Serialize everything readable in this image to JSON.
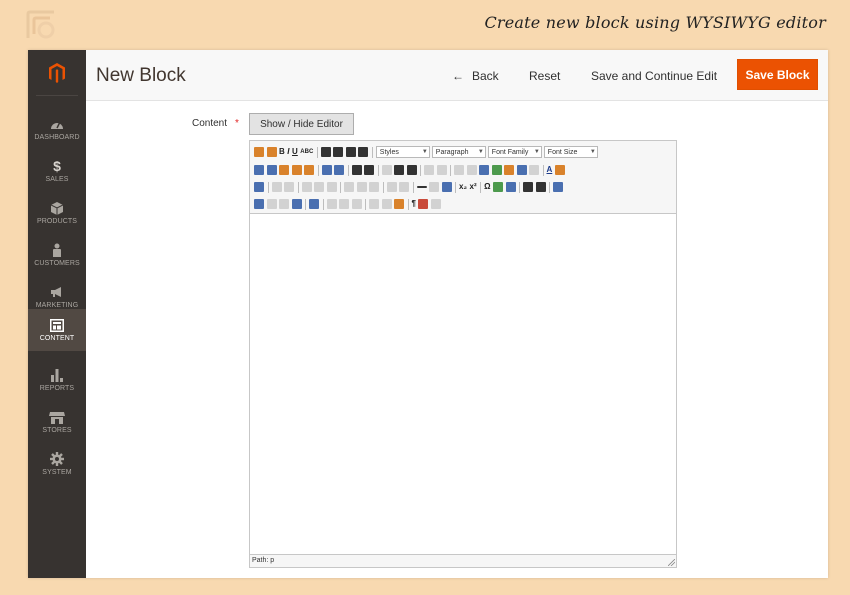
{
  "caption": "Create new block using WYSIWYG editor",
  "colors": {
    "accent": "#eb5202",
    "sidebar": "#373330",
    "background": "#f8d9b0"
  },
  "sidebar": {
    "items": [
      {
        "label": "DASHBOARD",
        "icon": "dashboard-icon"
      },
      {
        "label": "SALES",
        "icon": "dollar-icon"
      },
      {
        "label": "PRODUCTS",
        "icon": "cube-icon"
      },
      {
        "label": "CUSTOMERS",
        "icon": "person-icon"
      },
      {
        "label": "MARKETING",
        "icon": "megaphone-icon"
      },
      {
        "label": "CONTENT",
        "icon": "layout-icon",
        "active": true
      },
      {
        "label": "REPORTS",
        "icon": "bar-chart-icon"
      },
      {
        "label": "STORES",
        "icon": "store-icon"
      },
      {
        "label": "SYSTEM",
        "icon": "gear-icon"
      }
    ]
  },
  "header": {
    "title": "New Block",
    "back_label": "Back",
    "reset_label": "Reset",
    "save_continue_label": "Save and Continue Edit",
    "save_label": "Save Block"
  },
  "form": {
    "content_label": "Content",
    "required_mark": "*",
    "toggle_editor_label": "Show / Hide Editor"
  },
  "editor": {
    "selects": {
      "styles": "Styles",
      "format": "Paragraph",
      "font_family": "Font Family",
      "font_size": "Font Size"
    },
    "path_label": "Path: p"
  }
}
